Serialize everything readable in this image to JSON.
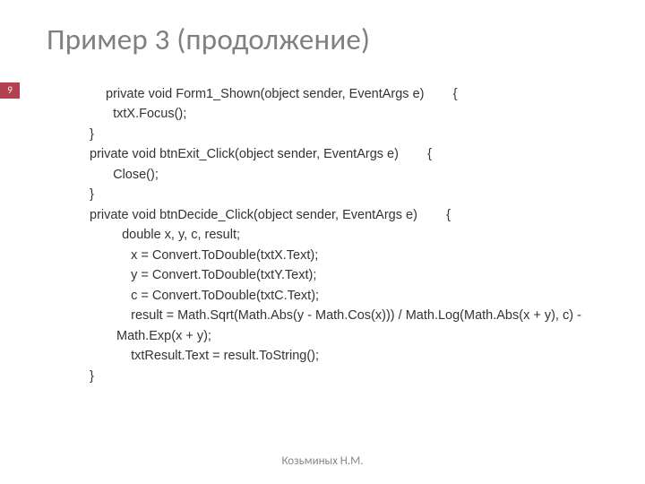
{
  "title": "Пример 3 (продолжение)",
  "slide_number": "9",
  "footer_author": "Козьминых Н.М.",
  "code": {
    "l01": " private void Form1_Shown(object sender, EventArgs e)        {",
    "l02": "   txtX.Focus();",
    "l03": "}",
    "l04": "private void btnExit_Click(object sender, EventArgs e)        {",
    "l05": "   Close();",
    "l06": "}",
    "l07": "private void btnDecide_Click(object sender, EventArgs e)        {",
    "l08": "   double x, y, c, result;",
    "l09": "    x = Convert.ToDouble(txtX.Text);",
    "l10": "    y = Convert.ToDouble(txtY.Text);",
    "l11": "    c = Convert.ToDouble(txtC.Text);",
    "l12": "    result = Math.Sqrt(Math.Abs(y - Math.Cos(x))) / Math.Log(Math.Abs(x + y), c) - Math.Exp(x + y);",
    "l13": "    txtResult.Text = result.ToString();",
    "l14": "}"
  }
}
